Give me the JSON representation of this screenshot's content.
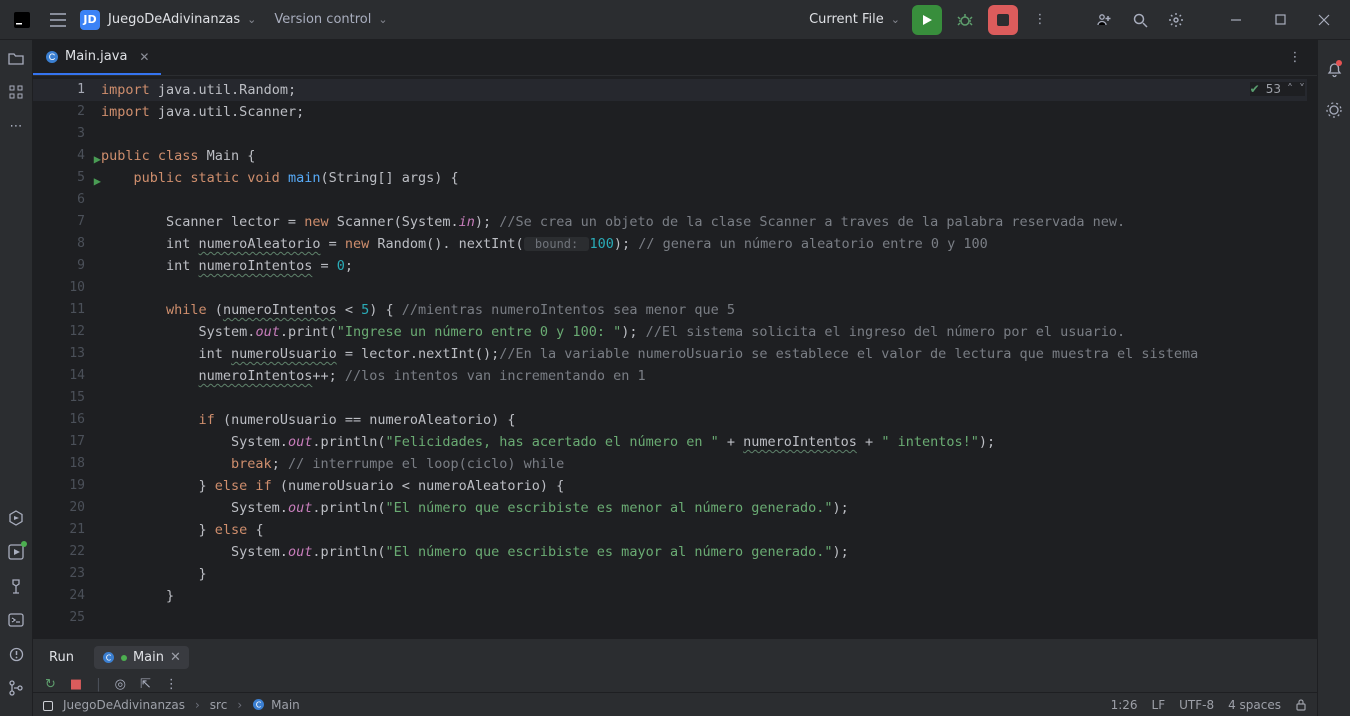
{
  "top": {
    "project_initials": "JD",
    "project_name": "JuegoDeAdivinanzas",
    "vcs_label": "Version control",
    "run_config": "Current File"
  },
  "tabs": {
    "file_name": "Main.java"
  },
  "inspections": {
    "count": "53"
  },
  "run_panel": {
    "label": "Run",
    "tab_name": "Main"
  },
  "gutter": {
    "lines": [
      "1",
      "2",
      "3",
      "4",
      "5",
      "6",
      "7",
      "8",
      "9",
      "10",
      "11",
      "12",
      "13",
      "14",
      "15",
      "16",
      "17",
      "18",
      "19",
      "20",
      "21",
      "22",
      "23",
      "24",
      "25"
    ],
    "run_markers": [
      4,
      5
    ]
  },
  "code": {
    "l1": {
      "a": "import",
      "b": " java.util.Random;"
    },
    "l2": {
      "a": "import",
      "b": " java.util.Scanner;"
    },
    "l4": {
      "a": "public class ",
      "b": "Main {"
    },
    "l5": {
      "a": "    public static void ",
      "fn": "main",
      "b": "(String[] args) {"
    },
    "l7": {
      "pre": "        Scanner lector = ",
      "kw": "new",
      "mid": " Scanner(System.",
      "field": "in",
      "post": "); ",
      "com": "//Se crea un objeto de la clase Scanner a traves de la palabra reservada new."
    },
    "l8": {
      "pre": "        int ",
      "var": "numeroAleatorio",
      "mid": " = ",
      "kw": "new",
      "mid2": " Random(). nextInt(",
      "hint": " bound: ",
      "num": "100",
      "mid3": "); ",
      "com": "// genera un número aleatorio entre 0 y 100"
    },
    "l9": {
      "pre": "        int ",
      "var": "numeroIntentos",
      "mid": " = ",
      "num": "0",
      "post": ";"
    },
    "l11": {
      "pre": "        ",
      "kw": "while",
      "mid": " (",
      "var": "numeroIntentos",
      "mid2": " < ",
      "num": "5",
      "mid3": ") { ",
      "com": "//mientras numeroIntentos sea menor que 5"
    },
    "l12": {
      "pre": "            System.",
      "field": "out",
      "mid": ".print(",
      "str": "\"Ingrese un número entre 0 y 100: \"",
      "mid2": "); ",
      "com": "//El sistema solicita el ingreso del número por el usuario."
    },
    "l13": {
      "pre": "            int ",
      "var": "numeroUsuario",
      "mid": " = lector.nextInt();",
      "com": "//En la variable numeroUsuario se establece el valor de lectura que muestra el sistema"
    },
    "l14": {
      "pre": "            ",
      "var": "numeroIntentos",
      "mid": "++; ",
      "com": "//los intentos van incrementando en 1"
    },
    "l16": {
      "pre": "            ",
      "kw": "if",
      "mid": " (numeroUsuario == numeroAleatorio) {"
    },
    "l17": {
      "pre": "                System.",
      "field": "out",
      "mid": ".println(",
      "str1": "\"Felicidades, has acertado el número en \"",
      "mid2": " + ",
      "var": "numeroIntentos",
      "mid3": " + ",
      "str2": "\" intentos!\"",
      "post": ");"
    },
    "l18": {
      "pre": "                ",
      "kw": "break",
      "mid": "; ",
      "com": "// interrumpe el loop(ciclo) while"
    },
    "l19": {
      "pre": "            } ",
      "kw": "else if",
      "mid": " (numeroUsuario < numeroAleatorio) {"
    },
    "l20": {
      "pre": "                System.",
      "field": "out",
      "mid": ".println(",
      "str": "\"El número que escribiste es menor al número generado.\"",
      "post": ");"
    },
    "l21": {
      "pre": "            } ",
      "kw": "else",
      "mid": " {"
    },
    "l22": {
      "pre": "                System.",
      "field": "out",
      "mid": ".println(",
      "str": "\"El número que escribiste es mayor al número generado.\"",
      "post": ");"
    },
    "l23": {
      "txt": "            }"
    },
    "l24": {
      "txt": "        }"
    }
  },
  "crumbs": {
    "root": "JuegoDeAdivinanzas",
    "folder": "src",
    "class": "Main",
    "caret": "1:26",
    "lf": "LF",
    "enc": "UTF-8",
    "indent": "4 spaces"
  }
}
